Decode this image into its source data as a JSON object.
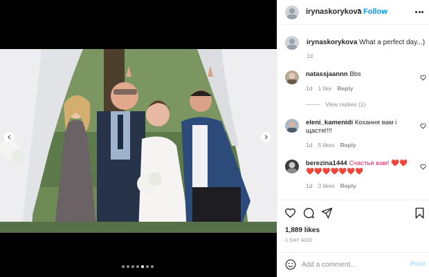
{
  "post": {
    "author": "irynaskorykova",
    "separator": "•",
    "follow_label": "Follow",
    "more_icon": "more-horizontal-icon",
    "photo": {
      "description_icon": "wedding-photo",
      "slides_count": 7,
      "active_slide": 5,
      "prev_icon": "chevron-left-icon",
      "next_icon": "chevron-right-icon"
    }
  },
  "caption": {
    "username": "irynaskorykova",
    "text": "What a perfect day...)",
    "time": "1d"
  },
  "comments": [
    {
      "username": "natassjaannn",
      "text": "Bbs",
      "time": "1d",
      "likes": "1 like",
      "reply": "Reply"
    },
    {
      "username": "eleni_kamenidi",
      "text": "Кохання вам і щастя!!!!",
      "time": "1d",
      "likes": "5 likes",
      "reply": "Reply"
    },
    {
      "username": "berezina1444",
      "text": "Счастья вам! ❤️❤️❤️❤️❤️❤️❤️❤️❤️",
      "time": "1d",
      "likes": "3 likes",
      "reply": "Reply"
    }
  ],
  "view_replies_label": "View replies (1)",
  "actions": {
    "like_icon": "heart-icon",
    "comment_icon": "comment-icon",
    "share_icon": "share-icon",
    "save_icon": "bookmark-icon"
  },
  "likes_label": "1,889 likes",
  "date_label": "1 DAY AGO",
  "add_comment": {
    "emoji_icon": "emoji-icon",
    "placeholder": "Add a comment...",
    "post_label": "Post"
  },
  "colors": {
    "link_blue": "#0095f6",
    "post_disabled": "#b2dffc",
    "muted": "#8e8e8e",
    "border": "#efefef"
  }
}
